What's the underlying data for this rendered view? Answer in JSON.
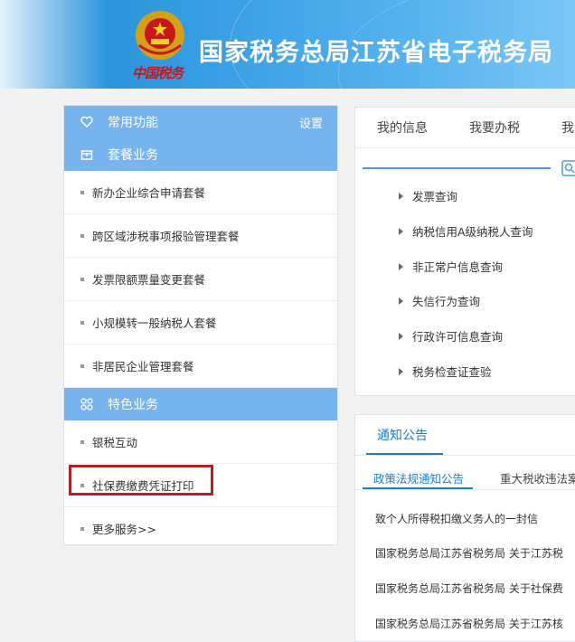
{
  "header": {
    "site_title": "国家税务总局江苏省电子税务局",
    "logo_text": "中国税务"
  },
  "left_panel": {
    "common_functions_label": "常用功能",
    "settings_label": "设置",
    "package_section_label": "套餐业务",
    "package_items": [
      "新办企业综合申请套餐",
      "跨区域涉税事项报验管理套餐",
      "发票限额票量变更套餐",
      "小规模转一般纳税人套餐",
      "非居民企业管理套餐"
    ],
    "featured_section_label": "特色业务",
    "featured_items": [
      "银税互动",
      "社保费缴费凭证打印",
      "更多服务>>"
    ]
  },
  "right_top": {
    "tabs": [
      "我的信息",
      "我要办税",
      "我"
    ],
    "query_items": [
      "发票查询",
      "纳税信用A级纳税人查询",
      "非正常户信息查询",
      "失信行为查询",
      "行政许可信息查询",
      "税务检查证查验"
    ]
  },
  "notices": {
    "title": "通知公告",
    "subtabs": [
      "政策法规通知公告",
      "重大税收违法案"
    ],
    "items": [
      "致个人所得税扣缴义务人的一封信",
      "国家税务总局江苏省税务局 关于江苏税",
      "国家税务总局江苏省税务局 关于社保费",
      "国家税务总局江苏省税务局 关于江苏核"
    ]
  },
  "colors": {
    "section_header": "#77b3ec",
    "highlight_border": "#b41f25",
    "link_blue": "#1a7ed0"
  }
}
